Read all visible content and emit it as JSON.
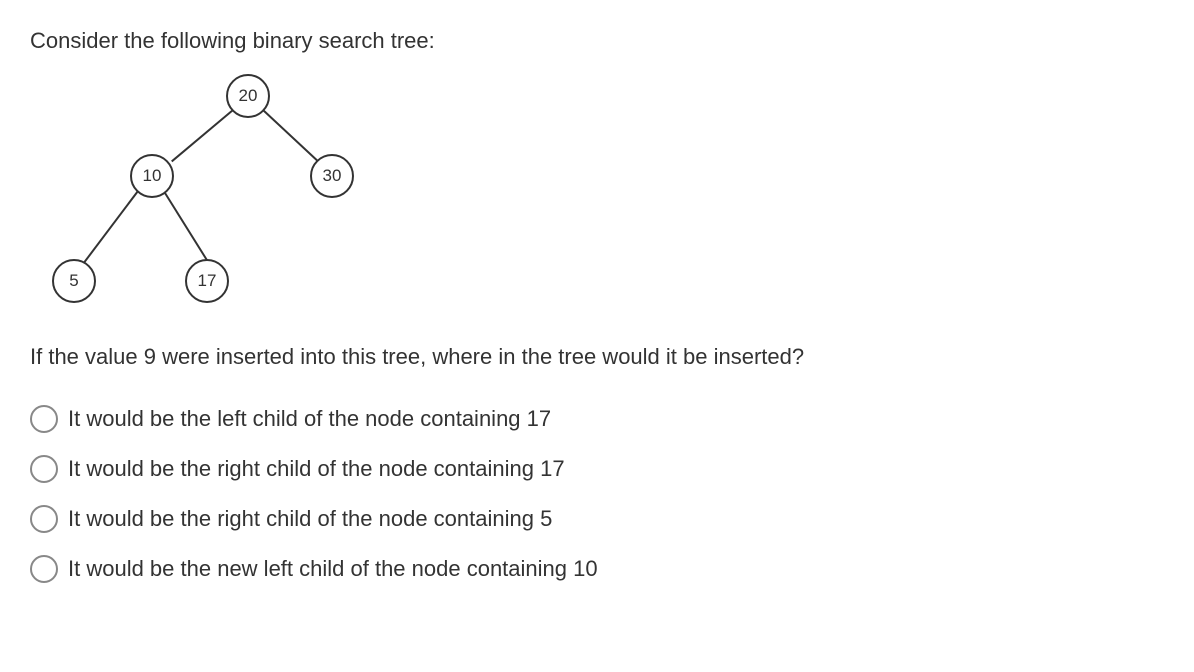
{
  "question_intro": "Consider the following binary search tree:",
  "tree": {
    "nodes": {
      "root": "20",
      "left": "10",
      "right": "30",
      "leftleft": "5",
      "leftright": "17"
    }
  },
  "question_text": "If the value 9 were inserted into this tree, where in the tree would it be inserted?",
  "options": [
    "It would be the left child of the node containing 17",
    "It would be the right child of the node containing 17",
    "It would be the right child of the node containing 5",
    "It would be the new left child of the node containing 10"
  ]
}
